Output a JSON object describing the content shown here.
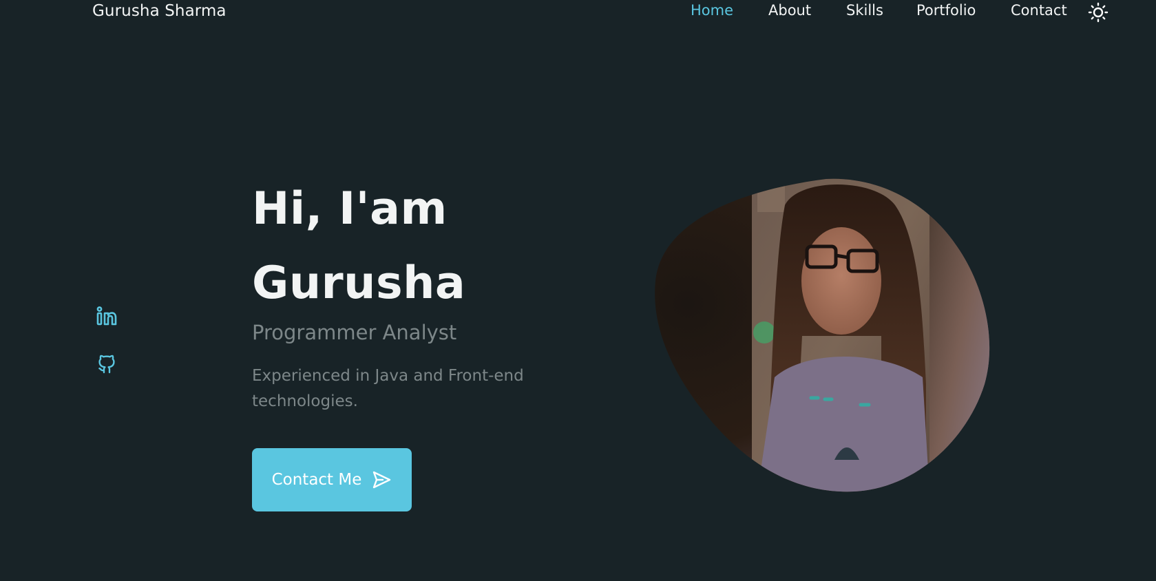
{
  "header": {
    "brand": "Gurusha Sharma",
    "nav": [
      {
        "label": "Home",
        "active": true
      },
      {
        "label": "About",
        "active": false
      },
      {
        "label": "Skills",
        "active": false
      },
      {
        "label": "Portfolio",
        "active": false
      },
      {
        "label": "Contact",
        "active": false
      }
    ],
    "theme_toggle_icon": "sun-icon"
  },
  "social": [
    {
      "name": "LinkedIn",
      "icon": "linkedin-icon"
    },
    {
      "name": "GitHub",
      "icon": "github-icon"
    }
  ],
  "hero": {
    "greeting": "Hi, I'am",
    "name": "Gurusha",
    "subtitle": "Programmer Analyst",
    "description": "Experienced in Java and Front-end technologies.",
    "cta": {
      "label": "Contact Me",
      "icon": "send-icon"
    }
  },
  "colors": {
    "background": "#182327",
    "accent": "#5ac6e0",
    "text": "#f2f4f4",
    "muted_text": "#7d8789"
  }
}
